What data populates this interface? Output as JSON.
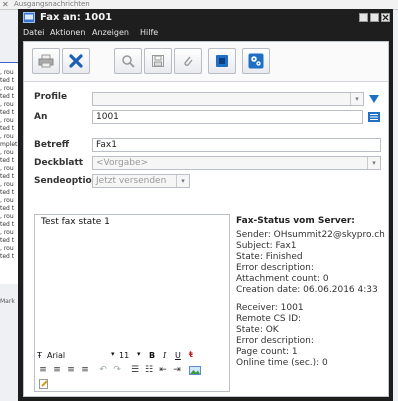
{
  "background": {
    "header_text": "Ausgangsnachrichten",
    "row_snippets": [
      ", rou",
      "ted t",
      ", rou",
      "ted t",
      ", rou",
      "ted t",
      ", rou",
      "ted t",
      ", rou",
      "mplet",
      ", rou",
      "ted t",
      ", rou",
      "ted t",
      ", rou",
      "ted t",
      ", rou",
      "ted t",
      ", rou",
      "ted t",
      ", rou",
      "ted t",
      ", rou",
      "ted t"
    ],
    "footer_text": "Mark"
  },
  "window": {
    "title": "Fax an: 1001",
    "menu": [
      "Datei",
      "Aktionen",
      "Anzeigen",
      "Hilfe"
    ]
  },
  "toolbar": {
    "buttons": [
      {
        "name": "print-button",
        "icon": "print-icon"
      },
      {
        "name": "delete-button",
        "icon": "delete-icon"
      },
      {
        "name": "search-button",
        "icon": "search-icon"
      },
      {
        "name": "save-button",
        "icon": "save-icon"
      },
      {
        "name": "attach-button",
        "icon": "attachment-icon"
      },
      {
        "name": "address-book-button",
        "icon": "address-book-icon"
      },
      {
        "name": "settings-button",
        "icon": "settings-icon"
      }
    ]
  },
  "form": {
    "profile_label": "Profile",
    "profile_value": "",
    "to_label": "An",
    "to_value": "1001",
    "subject_label": "Betreff",
    "subject_value": "Fax1",
    "cover_label": "Deckblatt",
    "cover_value": "<Vorgabe>",
    "send_options_label": "Sendeoptionen",
    "send_options_value": "Jetzt versenden"
  },
  "editor": {
    "body_text": "Test fax state 1",
    "font_name": "Arial",
    "font_size": "11"
  },
  "status": {
    "heading": "Fax-Status vom Server:",
    "lines_a": [
      "Sender: OHsummit22@skypro.ch",
      "Subject: Fax1",
      "State: Finished",
      "Error description:",
      "Attachment count: 0",
      "Creation date: 06.06.2016 4:33"
    ],
    "lines_b": [
      "Receiver: 1001",
      "Remote CS ID:",
      "State: OK",
      "Error description:",
      "Page count: 1",
      "Online time (sec.): 0"
    ]
  },
  "colors": {
    "titlebar": "#1e1e1e",
    "accent_blue": "#1f6fc5",
    "delete_blue": "#1b5fb8"
  }
}
